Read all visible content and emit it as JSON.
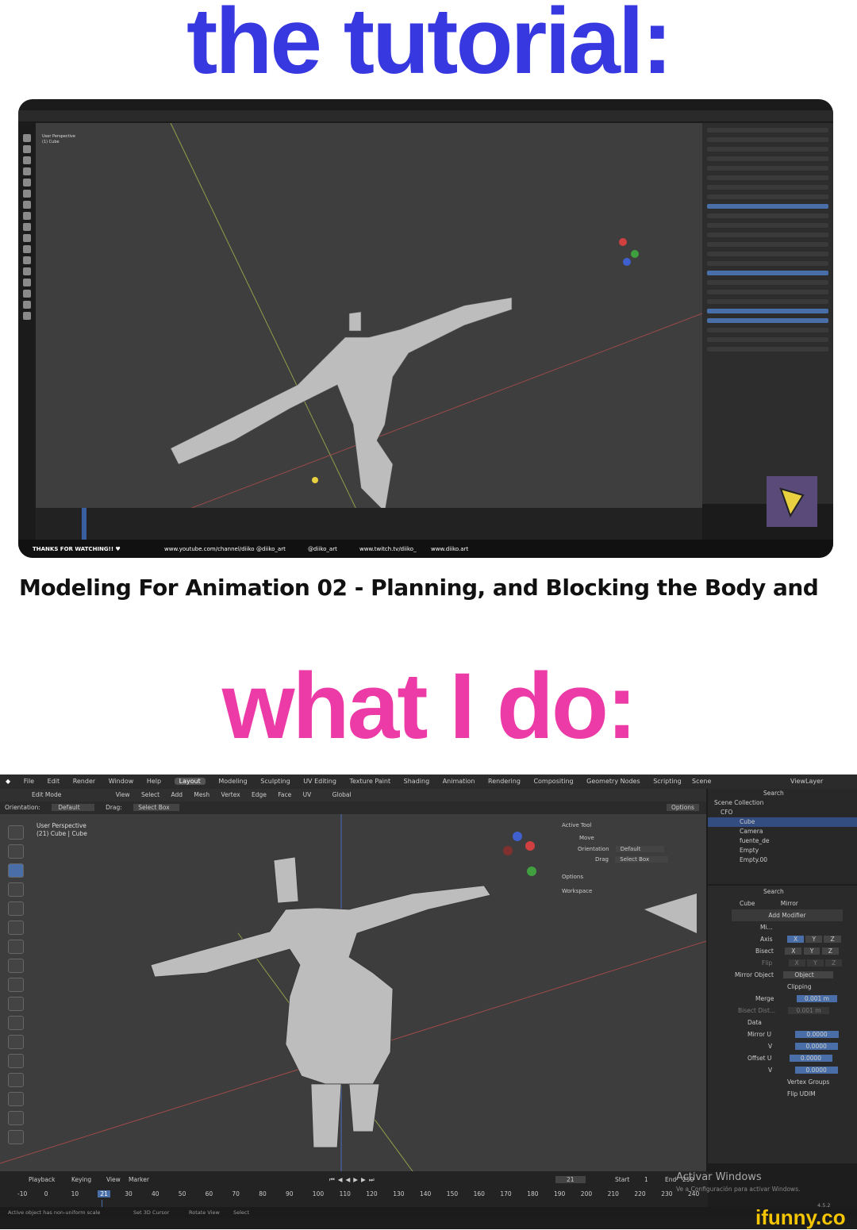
{
  "header1": {
    "text": "the tutorial:"
  },
  "caption": {
    "text": "Modeling For Animation 02 - Planning, and Blocking the Body and"
  },
  "header2": {
    "text": "what I do:"
  },
  "top_screenshot": {
    "viewport_info": [
      "User Perspective",
      "(1) Cube"
    ],
    "bottom_bar": {
      "thanks": "THANKS FOR WATCHING!! ♥",
      "youtube": "www.youtube.com/channel/diiko",
      "instagram": "@diiko_art",
      "twitter": "@diiko_art",
      "twitch": "www.twitch.tv/diiko_",
      "web": "www.diiko.art"
    }
  },
  "bottom_screenshot": {
    "menu": [
      "File",
      "Edit",
      "Render",
      "Window",
      "Help"
    ],
    "workspaces": [
      "Layout",
      "Modeling",
      "Sculpting",
      "UV Editing",
      "Texture Paint",
      "Shading",
      "Animation",
      "Rendering",
      "Compositing",
      "Geometry Nodes",
      "Scripting"
    ],
    "active_workspace": "Layout",
    "scene_label": "Scene",
    "viewlayer_label": "ViewLayer",
    "mode_row": [
      "Edit Mode",
      "View",
      "Select",
      "Add",
      "Mesh",
      "Vertex",
      "Edge",
      "Face",
      "UV",
      "Global"
    ],
    "orientation_row": {
      "label": "Orientation:",
      "value": "Default",
      "drag_label": "Drag:",
      "drag_value": "Select Box",
      "options": "Options"
    },
    "viewport_info": [
      "User Perspective",
      "(21) Cube | Cube"
    ],
    "npanel": {
      "active_tool": "Active Tool",
      "move": "Move",
      "orientation_label": "Orientation",
      "orientation_value": "Default",
      "drag_label": "Drag",
      "drag_value": "Select Box",
      "options": "Options",
      "workspace": "Workspace"
    },
    "outliner": {
      "search": "Search",
      "collection": "Scene Collection",
      "rows": [
        "CFO",
        "Cube",
        "Camera",
        "fuente_de",
        "Empty",
        "Empty.00"
      ]
    },
    "properties": {
      "search": "Search",
      "path": [
        "Cube",
        "Mirror"
      ],
      "add_modifier": "Add Modifier",
      "modifier_name": "Mi...",
      "axis_label": "Axis",
      "bisect_label": "Bisect",
      "flip_label": "Flip",
      "axes": [
        "X",
        "Y",
        "Z"
      ],
      "mirror_object_label": "Mirror Object",
      "mirror_object_placeholder": "Object",
      "clipping": "Clipping",
      "merge_label": "Merge",
      "merge_value": "0.001 m",
      "bisect_dist_label": "Bisect Dist...",
      "bisect_dist_value": "0.001 m",
      "data_label": "Data",
      "mirror_u_label": "Mirror U",
      "v_label": "V",
      "mirror_u_value": "0.0000",
      "mirror_v_value": "0.0000",
      "offset_u_label": "Offset U",
      "offset_u_value": "0.0000",
      "offset_v_value": "0.0000",
      "vertex_groups": "Vertex Groups",
      "flip_udim": "Flip UDIM"
    },
    "timeline": {
      "menu": [
        "Playback",
        "Keying",
        "View",
        "Marker"
      ],
      "current_frame": "21",
      "start_label": "Start",
      "start_value": "1",
      "end_label": "End",
      "end_value": "250",
      "ticks": [
        "-10",
        "0",
        "10",
        "21",
        "30",
        "40",
        "50",
        "60",
        "70",
        "80",
        "90",
        "100",
        "110",
        "120",
        "130",
        "140",
        "150",
        "160",
        "170",
        "180",
        "190",
        "200",
        "210",
        "220",
        "230",
        "240"
      ]
    },
    "status": [
      "Active object has non-uniform scale",
      "Set 3D Cursor",
      "Rotate View",
      "Select"
    ],
    "windows_watermark": "Activar Windows",
    "windows_watermark_sub": "Ve a Configuración para activar Windows.",
    "version": "4.5.2"
  },
  "watermark": "ifunny.co"
}
